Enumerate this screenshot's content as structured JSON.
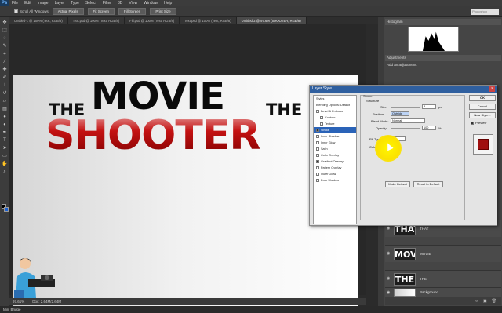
{
  "app": {
    "logo": "Ps"
  },
  "menu": [
    "File",
    "Edit",
    "Image",
    "Layer",
    "Type",
    "Select",
    "Filter",
    "3D",
    "View",
    "Window",
    "Help"
  ],
  "options_bar": {
    "scroll_all": "Scroll All Windows",
    "actual_pixels": "Actual Pixels",
    "fit_screen": "Fit Screen",
    "fill_screen": "Fill Screen",
    "print_size": "Print Size",
    "workspace": "Photoshop"
  },
  "doc_tabs": [
    "Untitled-1 @ 100% (Text, RGB/8)",
    "Text.psd @ 100% (Text, RGB/8)",
    "Fill.psd @ 100% (Text, RGB/8)",
    "Text.psd @ 100% (Text, RGB/8)",
    "Untitled-2 @ 97.6% (SHOOTER, RGB/8)"
  ],
  "canvas_text": {
    "the_left": "THE",
    "movie": "MOVIE",
    "the_right": "THE",
    "shooter": "SHOOTER"
  },
  "status": {
    "zoom": "97.61%",
    "doc": "Doc: 2.64M/2.64M"
  },
  "bottom_bar": {
    "label": "Mini Bridge"
  },
  "panels": {
    "histogram_tab": "Histogram",
    "adjustments_tab": "Adjustments",
    "adjustments_label": "Add an adjustment"
  },
  "layers": [
    {
      "thumb": "THAT",
      "name": "THAT"
    },
    {
      "thumb": "MOVI",
      "name": "MOVIE"
    },
    {
      "thumb": "THE",
      "name": "THE"
    },
    {
      "thumb": "",
      "name": "Background"
    }
  ],
  "dialog": {
    "title": "Layer Style",
    "styles": [
      {
        "label": "Styles",
        "check": false,
        "selected": false
      },
      {
        "label": "Blending Options: Default",
        "check": false,
        "selected": false
      },
      {
        "label": "Bevel & Emboss",
        "check": true,
        "on": false,
        "selected": false
      },
      {
        "label": "Contour",
        "check": true,
        "on": false,
        "selected": false
      },
      {
        "label": "Texture",
        "check": true,
        "on": false,
        "selected": false
      },
      {
        "label": "Stroke",
        "check": true,
        "on": true,
        "selected": true
      },
      {
        "label": "Inner Shadow",
        "check": true,
        "on": false,
        "selected": false
      },
      {
        "label": "Inner Glow",
        "check": true,
        "on": false,
        "selected": false
      },
      {
        "label": "Satin",
        "check": true,
        "on": false,
        "selected": false
      },
      {
        "label": "Color Overlay",
        "check": true,
        "on": false,
        "selected": false
      },
      {
        "label": "Gradient Overlay",
        "check": true,
        "on": true,
        "selected": false
      },
      {
        "label": "Pattern Overlay",
        "check": true,
        "on": false,
        "selected": false
      },
      {
        "label": "Outer Glow",
        "check": true,
        "on": false,
        "selected": false
      },
      {
        "label": "Drop Shadow",
        "check": true,
        "on": false,
        "selected": false
      }
    ],
    "stroke_header": "Stroke",
    "structure_header": "Structure",
    "size_label": "Size:",
    "size_value": "3",
    "size_unit": "px",
    "position_label": "Position:",
    "position_value": "Outside",
    "blend_label": "Blend Mode:",
    "blend_value": "Normal",
    "opacity_label": "Opacity:",
    "opacity_value": "100",
    "opacity_unit": "%",
    "fill_type_label": "Fill Type:",
    "fill_type_value": "Color",
    "color_label": "Color:",
    "make_default": "Make Default",
    "reset_default": "Reset to Default",
    "ok": "OK",
    "cancel": "Cancel",
    "new_style": "New Style...",
    "preview": "Preview"
  },
  "colors": {
    "accent_red": "#c41212",
    "dialog_title": "#2f5f9f",
    "highlight": "#fbe200"
  }
}
